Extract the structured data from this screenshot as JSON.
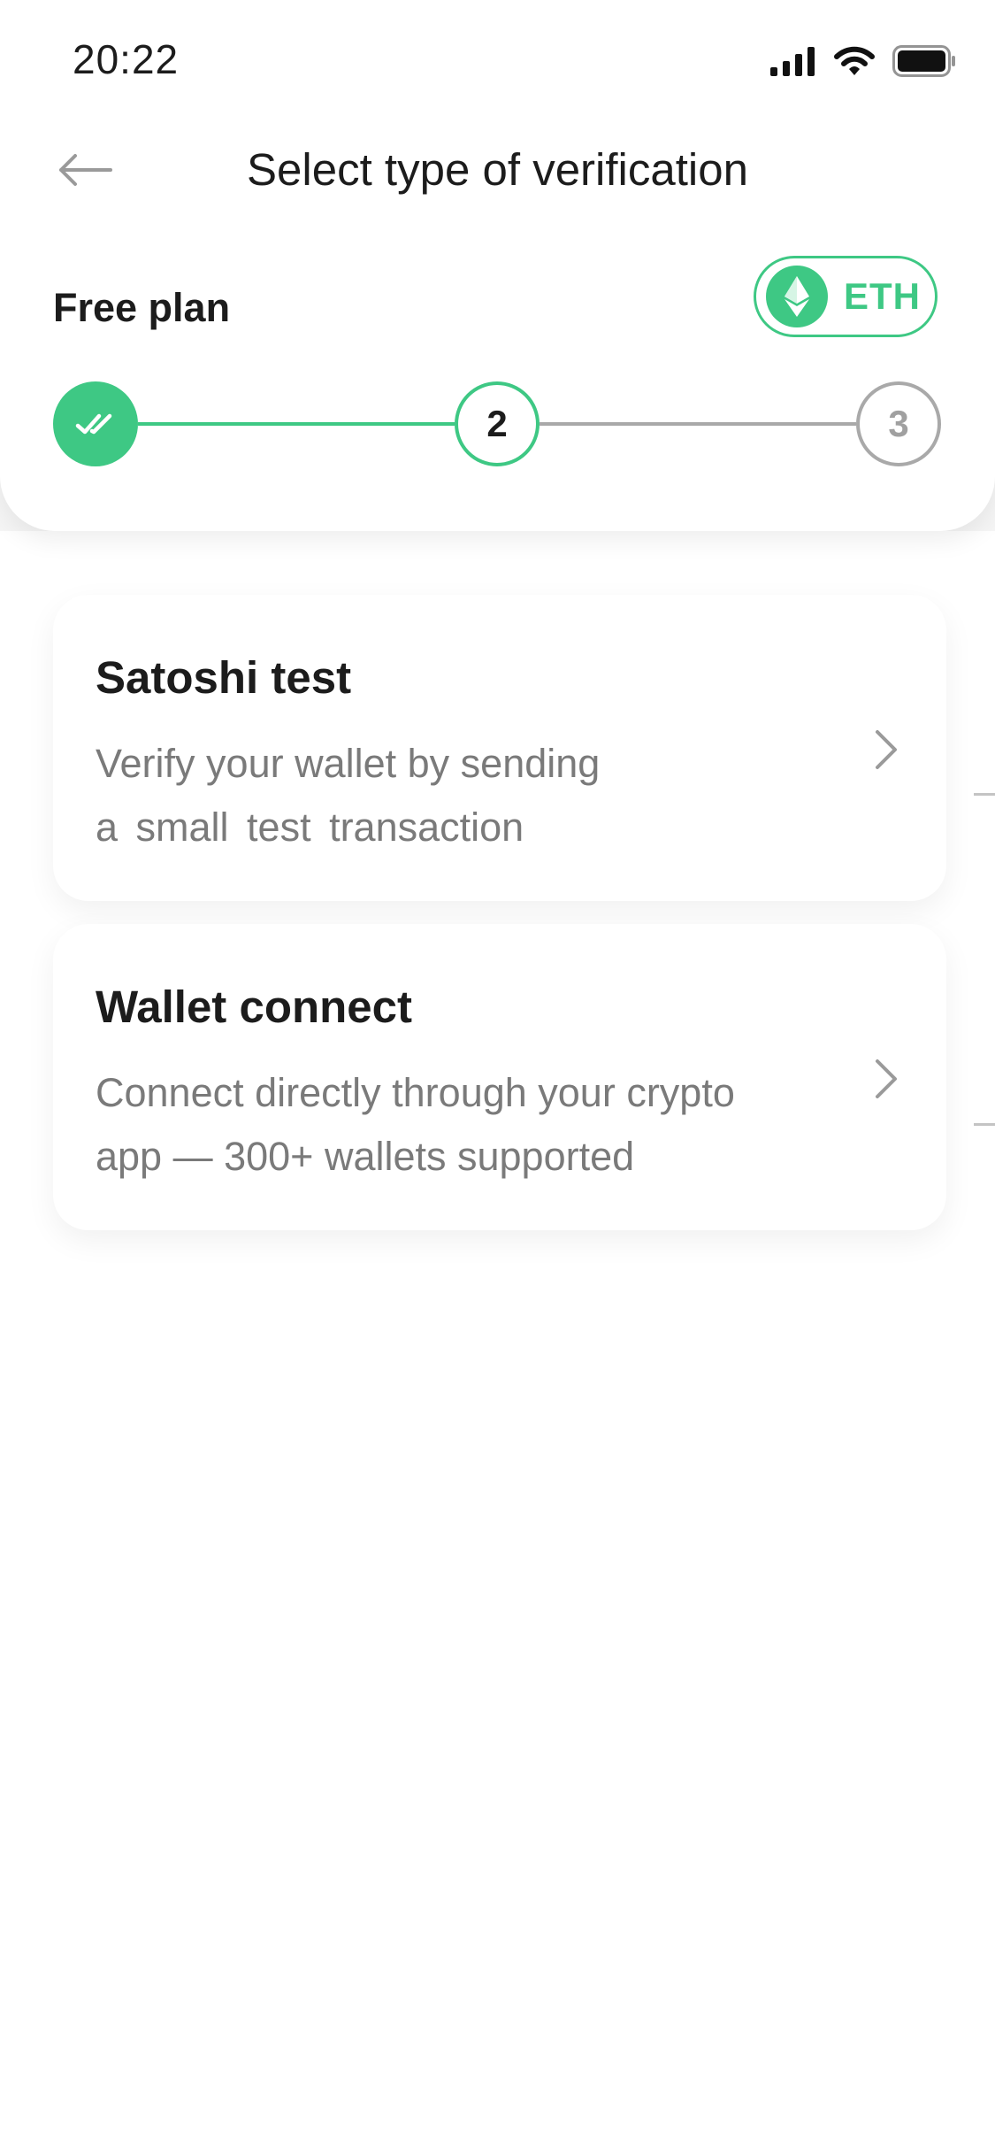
{
  "status_bar": {
    "time": "20:22"
  },
  "header": {
    "title": "Select type of verification"
  },
  "plan": {
    "label": "Free plan",
    "currency": "ETH"
  },
  "stepper": {
    "step2": "2",
    "step3": "3"
  },
  "options": [
    {
      "title": "Satoshi test",
      "desc_line1": "Verify your wallet by sending",
      "desc_line2": "a small test transaction"
    },
    {
      "title": "Wallet connect",
      "desc_line1": "Connect directly through your crypto",
      "desc_line2": "app — 300+ wallets supported"
    }
  ],
  "colors": {
    "accent": "#3ec884",
    "inactive": "#a9a9a9",
    "text": "#1c1c1c",
    "muted": "#7a7a7a"
  },
  "icons": [
    "signal-icon",
    "wifi-icon",
    "battery-icon",
    "back-arrow-icon",
    "ethereum-icon",
    "double-check-icon",
    "chevron-right-icon"
  ]
}
